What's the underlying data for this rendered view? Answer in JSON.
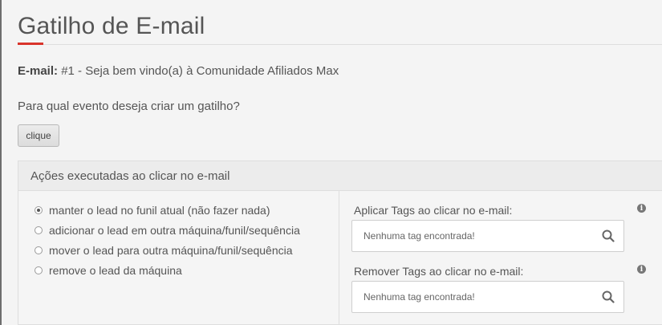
{
  "page": {
    "title": "Gatilho de E-mail"
  },
  "email": {
    "label": "E-mail:",
    "value": "#1 - Seja bem vindo(a) à Comunidade Afiliados Max"
  },
  "event": {
    "question": "Para qual evento deseja criar um gatilho?",
    "button_label": "clique"
  },
  "actions_panel": {
    "header": "Ações executadas ao clicar no e-mail",
    "options": [
      {
        "label": "manter o lead no funil atual (não fazer nada)",
        "checked": true
      },
      {
        "label": "adicionar o lead em outra máquina/funil/sequência",
        "checked": false
      },
      {
        "label": "mover o lead para outra máquina/funil/sequência",
        "checked": false
      },
      {
        "label": "remove o lead da máquina",
        "checked": false
      }
    ],
    "apply_tags": {
      "label": "Aplicar Tags ao clicar no e-mail:",
      "placeholder": "Nenhuma tag encontrada!"
    },
    "remove_tags": {
      "label": "Remover Tags ao clicar no e-mail:",
      "placeholder": "Nenhuma tag encontrada!"
    }
  },
  "icons": {
    "info": "info-icon",
    "search": "search-icon"
  },
  "colors": {
    "accent": "#d9342b",
    "text": "#555555",
    "panel_header": "#ececec"
  }
}
